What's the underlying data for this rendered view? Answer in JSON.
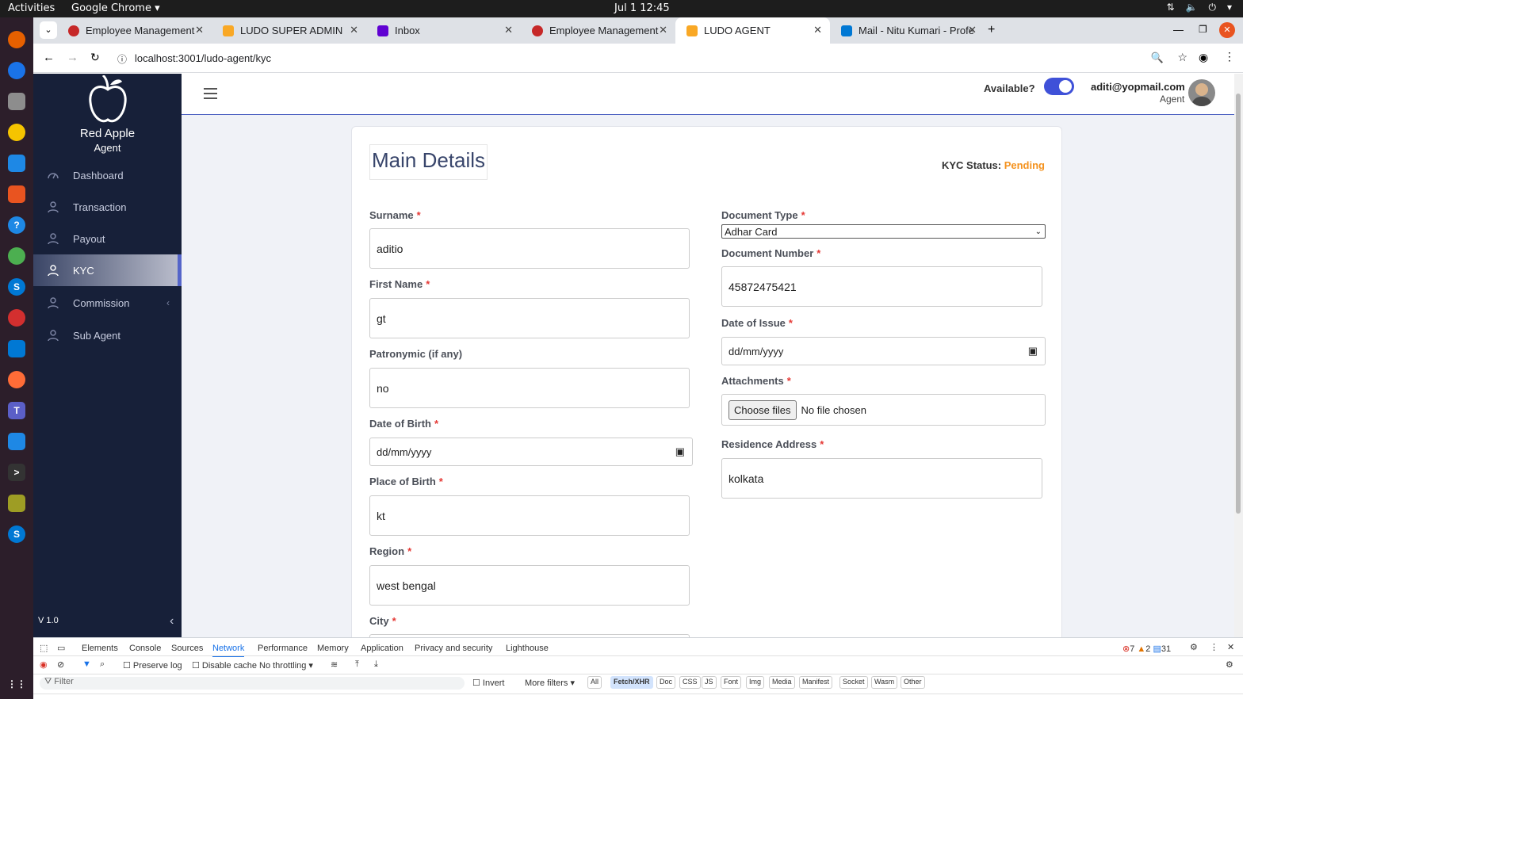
{
  "os": {
    "activities": "Activities",
    "app": "Google Chrome",
    "clock": "Jul 1  12:45"
  },
  "tabs": [
    {
      "title": "Employee Management"
    },
    {
      "title": "LUDO SUPER ADMIN"
    },
    {
      "title": "Inbox"
    },
    {
      "title": "Employee Management"
    },
    {
      "title": "LUDO AGENT"
    },
    {
      "title": "Mail - Nitu Kumari - Profe"
    }
  ],
  "address": {
    "url": "localhost:3001/ludo-agent/kyc"
  },
  "sidebar": {
    "brand": "Red Apple",
    "role": "Agent",
    "version": "V 1.0",
    "items": [
      {
        "label": "Dashboard"
      },
      {
        "label": "Transaction"
      },
      {
        "label": "Payout"
      },
      {
        "label": "KYC"
      },
      {
        "label": "Commission"
      },
      {
        "label": "Sub Agent"
      }
    ]
  },
  "header": {
    "available_label": "Available?",
    "email": "aditi@yopmail.com",
    "role": "Agent"
  },
  "form": {
    "title": "Main Details",
    "kyc_status_label": "KYC Status:",
    "kyc_status": "Pending",
    "surname": {
      "label": "Surname",
      "value": "aditio"
    },
    "first_name": {
      "label": "First Name",
      "value": "gt"
    },
    "patronymic": {
      "label": "Patronymic (if any)",
      "value": "no"
    },
    "dob": {
      "label": "Date of Birth",
      "value": "dd/mm/yyyy"
    },
    "pob": {
      "label": "Place of Birth",
      "value": "kt"
    },
    "region": {
      "label": "Region",
      "value": "west bengal"
    },
    "city": {
      "label": "City"
    },
    "doc_type": {
      "label": "Document Type",
      "value": "Adhar Card"
    },
    "doc_number": {
      "label": "Document Number",
      "value": "45872475421"
    },
    "issue_date": {
      "label": "Date of Issue",
      "value": "dd/mm/yyyy"
    },
    "attachments": {
      "label": "Attachments",
      "button": "Choose files",
      "status": "No file chosen"
    },
    "address": {
      "label": "Residence Address",
      "value": "kolkata"
    }
  },
  "devtools": {
    "tabs": [
      "Elements",
      "Console",
      "Sources",
      "Network",
      "Performance",
      "Memory",
      "Application",
      "Privacy and security",
      "Lighthouse"
    ],
    "errors": "7",
    "warnings": "2",
    "messages": "31",
    "preserve_log": "Preserve log",
    "disable_cache": "Disable cache",
    "throttling": "No throttling",
    "filter": "Filter",
    "invert": "Invert",
    "more_filters": "More filters",
    "chips": [
      "All",
      "Fetch/XHR",
      "Doc",
      "CSS",
      "JS",
      "Font",
      "Img",
      "Media",
      "Manifest",
      "Socket",
      "Wasm",
      "Other"
    ]
  }
}
